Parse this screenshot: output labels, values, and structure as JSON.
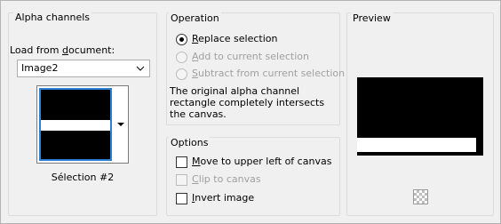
{
  "alpha_group": {
    "title": "Alpha channels",
    "load_label_pre": "Load from ",
    "load_label_u": "d",
    "load_label_post": "ocument:",
    "document_value": "Image2",
    "selection_name": "Sélection #2"
  },
  "operation_group": {
    "title": "Operation",
    "options": [
      {
        "u": "R",
        "rest": "eplace selection",
        "checked": true,
        "enabled": true
      },
      {
        "u": "A",
        "rest": "dd to current selection",
        "checked": false,
        "enabled": false
      },
      {
        "u": "S",
        "rest": "ubtract from current selection",
        "checked": false,
        "enabled": false
      }
    ],
    "description": "The original alpha channel rectangle completely intersects the canvas."
  },
  "options_group": {
    "title": "Options",
    "items": [
      {
        "u": "M",
        "rest": "ove to upper left of canvas",
        "checked": false,
        "enabled": true
      },
      {
        "u": "C",
        "rest": "lip to canvas",
        "checked": false,
        "enabled": false
      },
      {
        "u": "I",
        "rest": "nvert image",
        "checked": false,
        "enabled": true
      }
    ]
  },
  "preview_group": {
    "title": "Preview",
    "transparency_icon": "checkerboard-icon"
  },
  "colors": {
    "thumb_border": "#2f7fd4",
    "canvas": "#000000",
    "selection": "#ffffff"
  }
}
